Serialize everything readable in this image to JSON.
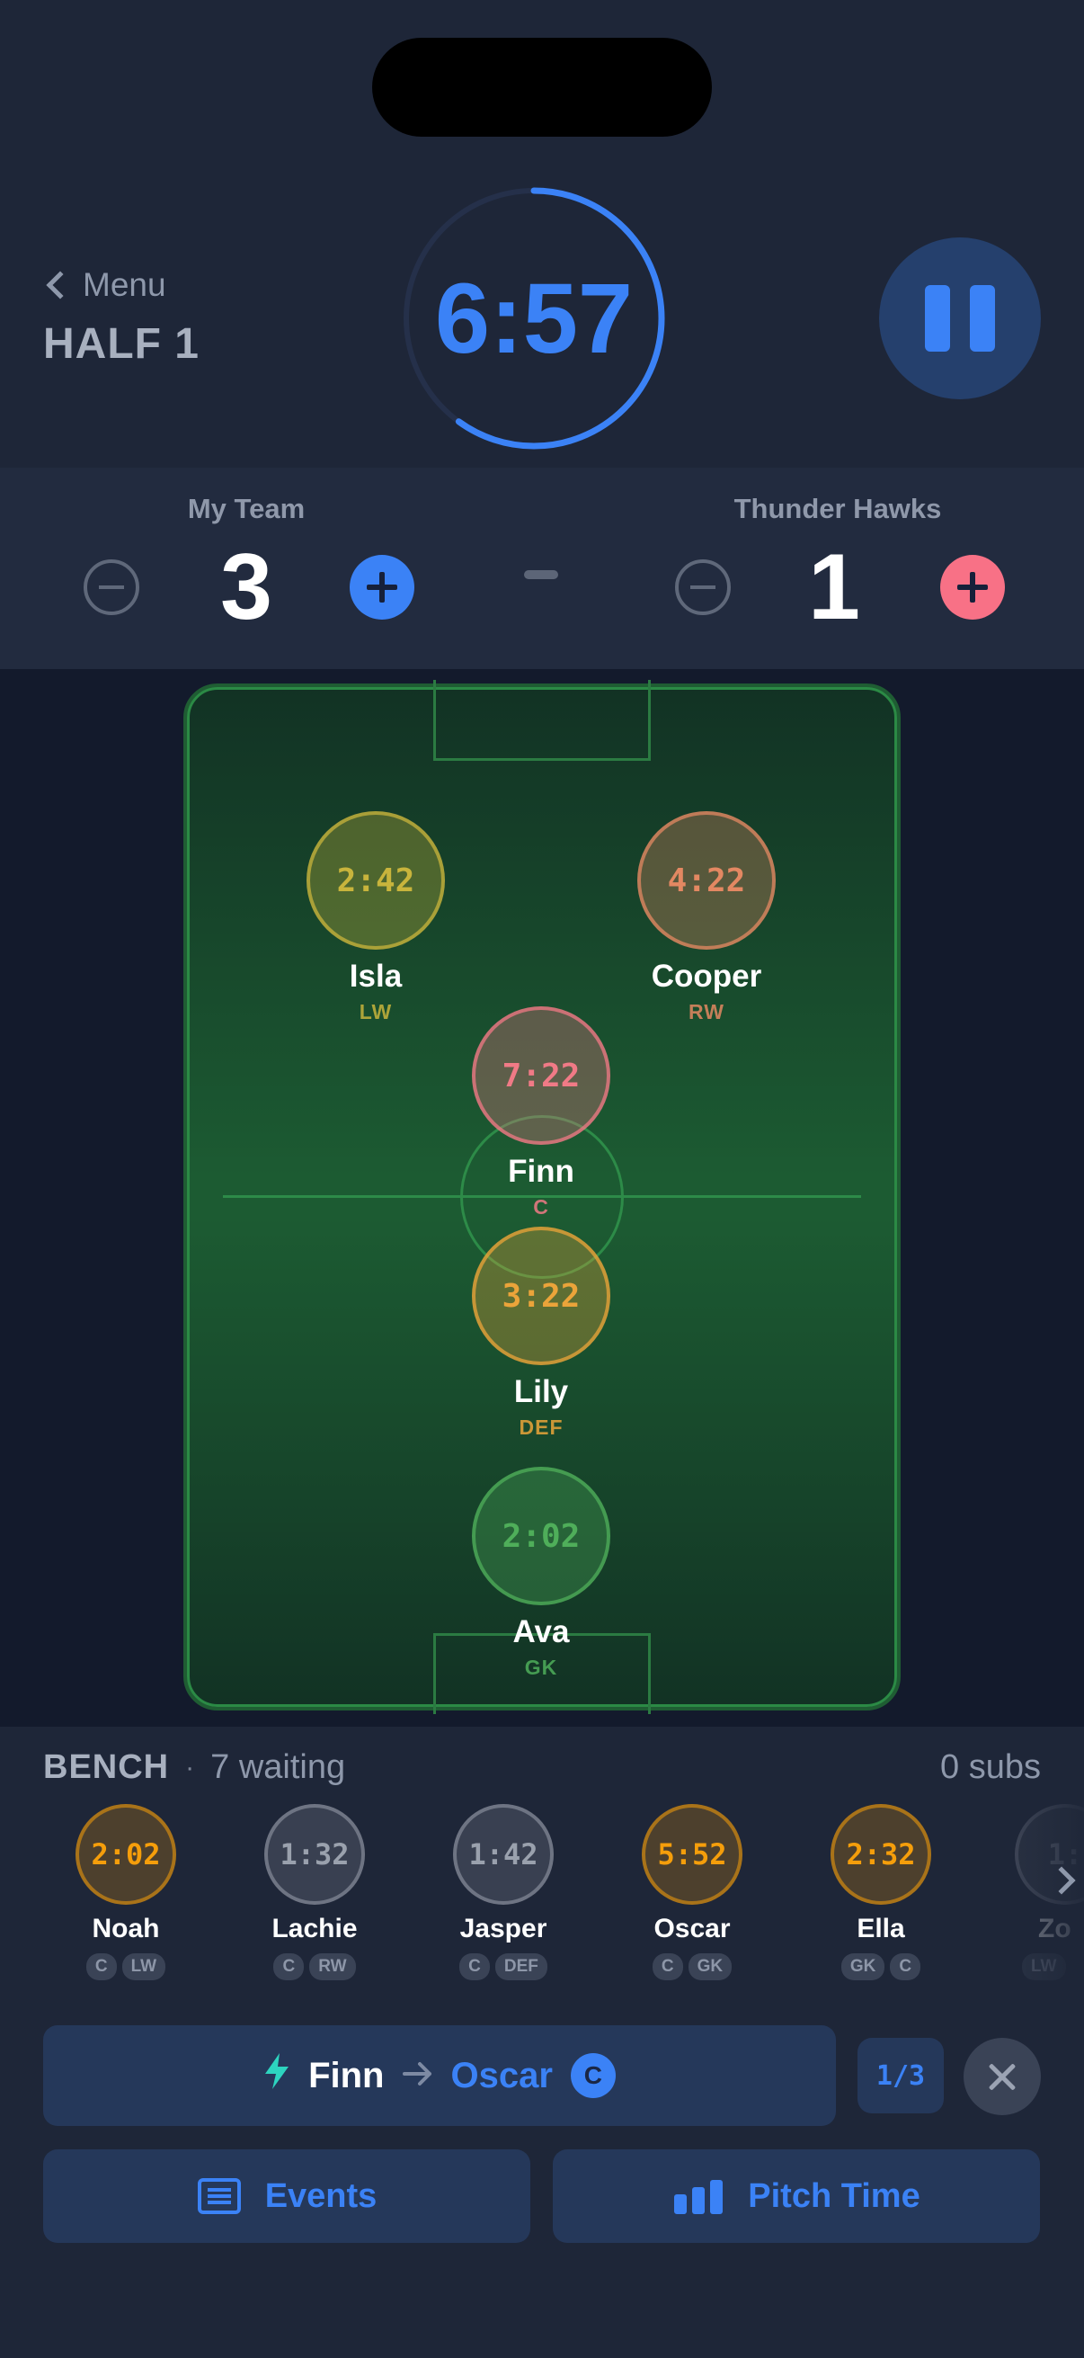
{
  "header": {
    "back_label": "Menu",
    "period": "HALF 1",
    "clock": "6:57",
    "clock_progress": 0.6
  },
  "score": {
    "home": {
      "name": "My Team",
      "value": "3",
      "accent": "#3b82f6"
    },
    "away": {
      "name": "Thunder Hawks",
      "value": "1",
      "accent": "#f87186"
    }
  },
  "pitch": {
    "players": [
      {
        "time": "2:42",
        "name": "Isla",
        "pos": "LW",
        "color": "#c8b43c"
      },
      {
        "time": "4:22",
        "name": "Cooper",
        "pos": "RW",
        "color": "#e38862"
      },
      {
        "time": "7:22",
        "name": "Finn",
        "pos": "C",
        "color": "#f07a86"
      },
      {
        "time": "3:22",
        "name": "Lily",
        "pos": "DEF",
        "color": "#eba43a"
      },
      {
        "time": "2:02",
        "name": "Ava",
        "pos": "GK",
        "color": "#4fae5a"
      }
    ]
  },
  "bench": {
    "title": "BENCH",
    "waiting": "7 waiting",
    "subs": "0 subs",
    "players": [
      {
        "time": "2:02",
        "name": "Noah",
        "tags": [
          "C",
          "LW"
        ],
        "color": "#f59e0b"
      },
      {
        "time": "1:32",
        "name": "Lachie",
        "tags": [
          "C",
          "RW"
        ],
        "color": "#9aa1ad"
      },
      {
        "time": "1:42",
        "name": "Jasper",
        "tags": [
          "C",
          "DEF"
        ],
        "color": "#9aa1ad"
      },
      {
        "time": "5:52",
        "name": "Oscar",
        "tags": [
          "C",
          "GK"
        ],
        "color": "#f59e0b"
      },
      {
        "time": "2:32",
        "name": "Ella",
        "tags": [
          "GK",
          "C"
        ],
        "color": "#f59e0b"
      },
      {
        "time": "1:",
        "name": "Zo",
        "tags": [
          "LW"
        ],
        "color": "#9aa1ad"
      }
    ]
  },
  "substitution": {
    "out": "Finn",
    "in": "Oscar",
    "badge": "C",
    "counter": "1/3"
  },
  "actions": {
    "events_label": "Events",
    "pitch_time_label": "Pitch Time"
  }
}
